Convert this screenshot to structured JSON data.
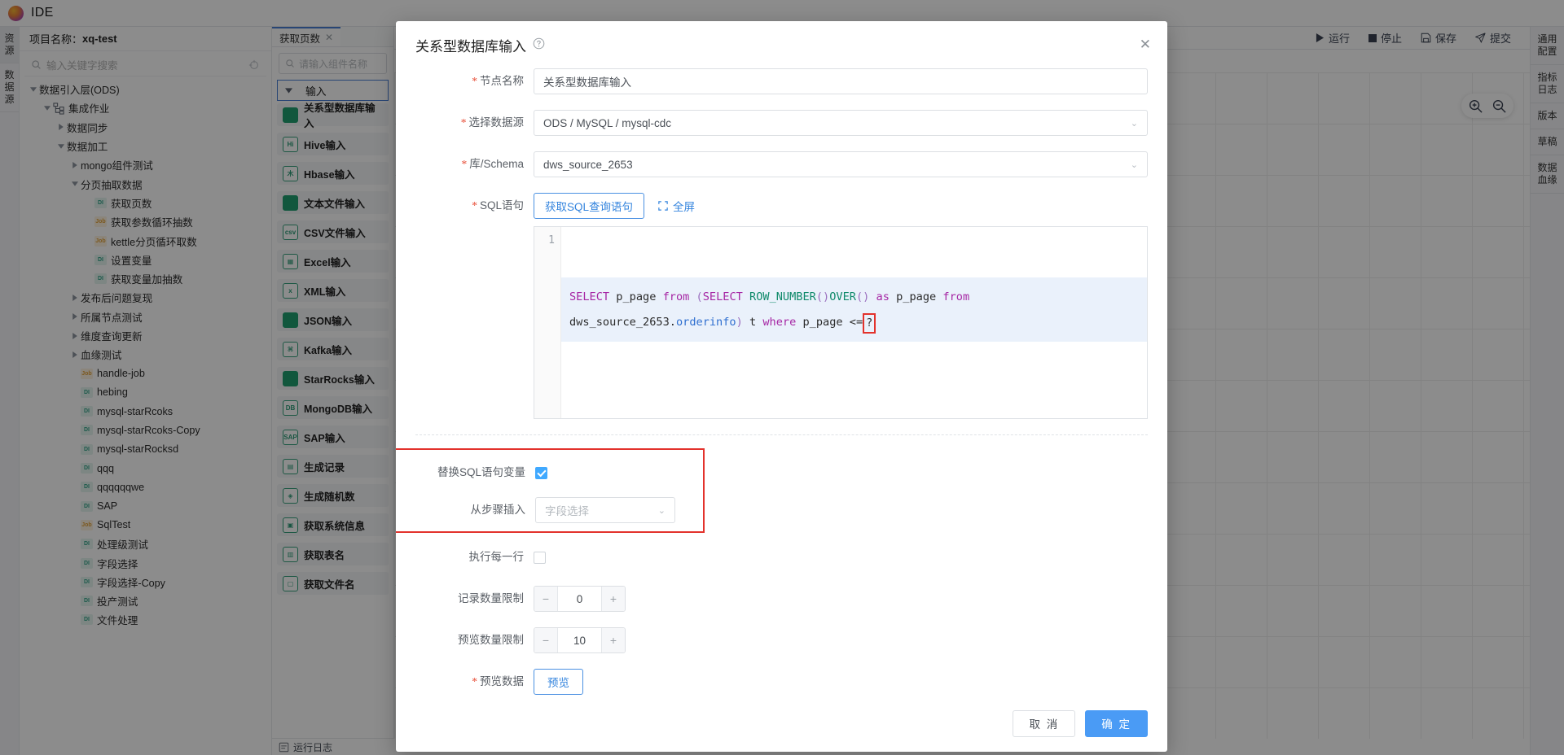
{
  "app": {
    "title": "IDE",
    "logo_icon": "flame-logo-icon"
  },
  "left_rail": {
    "tabs": [
      {
        "label": "资源",
        "active": true
      },
      {
        "label": "数据源",
        "active": false
      }
    ]
  },
  "tree": {
    "project_label": "项目名称：",
    "project_name": "xq-test",
    "search_placeholder": "输入关键字搜索",
    "search_icon": "search-icon",
    "target_icon": "crosshair-icon",
    "nodes": [
      {
        "label": "数据引入层(ODS)",
        "indent": 0,
        "caret": "down",
        "icon": ""
      },
      {
        "label": "集成作业",
        "indent": 1,
        "caret": "down",
        "icon": "net"
      },
      {
        "label": "数据同步",
        "indent": 2,
        "caret": "right",
        "icon": ""
      },
      {
        "label": "数据加工",
        "indent": 2,
        "caret": "down",
        "icon": ""
      },
      {
        "label": "mongo组件测试",
        "indent": 3,
        "caret": "right",
        "icon": ""
      },
      {
        "label": "分页抽取数据",
        "indent": 3,
        "caret": "down",
        "icon": ""
      },
      {
        "label": "获取页数",
        "indent": 4,
        "caret": "none",
        "icon": "DI"
      },
      {
        "label": "获取参数循环抽数",
        "indent": 4,
        "caret": "none",
        "icon": "Job"
      },
      {
        "label": "kettle分页循环取数",
        "indent": 4,
        "caret": "none",
        "icon": "Job"
      },
      {
        "label": "设置变量",
        "indent": 4,
        "caret": "none",
        "icon": "DI"
      },
      {
        "label": "获取变量加抽数",
        "indent": 4,
        "caret": "none",
        "icon": "DI"
      },
      {
        "label": "发布后问题复现",
        "indent": 3,
        "caret": "right",
        "icon": ""
      },
      {
        "label": "所属节点测试",
        "indent": 3,
        "caret": "right",
        "icon": ""
      },
      {
        "label": "维度查询更新",
        "indent": 3,
        "caret": "right",
        "icon": ""
      },
      {
        "label": "血缘测试",
        "indent": 3,
        "caret": "right",
        "icon": ""
      },
      {
        "label": "handle-job",
        "indent": 3,
        "caret": "none",
        "icon": "Job"
      },
      {
        "label": "hebing",
        "indent": 3,
        "caret": "none",
        "icon": "DI"
      },
      {
        "label": "mysql-starRcoks",
        "indent": 3,
        "caret": "none",
        "icon": "DI"
      },
      {
        "label": "mysql-starRcoks-Copy",
        "indent": 3,
        "caret": "none",
        "icon": "DI"
      },
      {
        "label": "mysql-starRocksd",
        "indent": 3,
        "caret": "none",
        "icon": "DI"
      },
      {
        "label": "qqq",
        "indent": 3,
        "caret": "none",
        "icon": "DI"
      },
      {
        "label": "qqqqqqwe",
        "indent": 3,
        "caret": "none",
        "icon": "DI"
      },
      {
        "label": "SAP",
        "indent": 3,
        "caret": "none",
        "icon": "DI"
      },
      {
        "label": "SqlTest",
        "indent": 3,
        "caret": "none",
        "icon": "Job"
      },
      {
        "label": "处理级测试",
        "indent": 3,
        "caret": "none",
        "icon": "DI"
      },
      {
        "label": "字段选择",
        "indent": 3,
        "caret": "none",
        "icon": "DI"
      },
      {
        "label": "字段选择-Copy",
        "indent": 3,
        "caret": "none",
        "icon": "DI"
      },
      {
        "label": "投产测试",
        "indent": 3,
        "caret": "none",
        "icon": "DI"
      },
      {
        "label": "文件处理",
        "indent": 3,
        "caret": "none",
        "icon": "DI"
      }
    ]
  },
  "palette": {
    "tab_label": "获取页数",
    "tab_close_icon": "close-icon",
    "search_placeholder": "请输入组件名称",
    "search_icon": "search-icon",
    "group_label": "输入",
    "group_caret_icon": "caret-down-icon",
    "components": [
      {
        "label": "关系型数据库输入",
        "icon": "database-icon",
        "solid": true
      },
      {
        "label": "Hive输入",
        "icon": "hive-icon",
        "glyph": "Hi"
      },
      {
        "label": "Hbase输入",
        "icon": "hbase-icon",
        "glyph": "木"
      },
      {
        "label": "文本文件输入",
        "icon": "text-file-icon",
        "solid": true
      },
      {
        "label": "CSV文件输入",
        "icon": "csv-file-icon",
        "glyph": "csv"
      },
      {
        "label": "Excel输入",
        "icon": "excel-icon",
        "glyph": "▦"
      },
      {
        "label": "XML输入",
        "icon": "xml-file-icon",
        "glyph": "x"
      },
      {
        "label": "JSON输入",
        "icon": "json-icon",
        "solid": true
      },
      {
        "label": "Kafka输入",
        "icon": "kafka-icon",
        "glyph": "⌘"
      },
      {
        "label": "StarRocks输入",
        "icon": "starrocks-icon",
        "solid": true
      },
      {
        "label": "MongoDB输入",
        "icon": "mongodb-icon",
        "glyph": "DB"
      },
      {
        "label": "SAP输入",
        "icon": "sap-icon",
        "glyph": "SAP"
      },
      {
        "label": "生成记录",
        "icon": "generate-record-icon",
        "glyph": "▤"
      },
      {
        "label": "生成随机数",
        "icon": "random-number-icon",
        "glyph": "◈"
      },
      {
        "label": "获取系统信息",
        "icon": "system-info-icon",
        "glyph": "▣"
      },
      {
        "label": "获取表名",
        "icon": "table-name-icon",
        "glyph": "▥"
      },
      {
        "label": "获取文件名",
        "icon": "file-name-icon",
        "glyph": "▢"
      }
    ],
    "run_log_label": "运行日志",
    "run_log_icon": "log-icon"
  },
  "canvas_toolbar": {
    "collapse_icon": "chevron-double-down-icon",
    "buttons": [
      {
        "label": "运行",
        "icon": "play-icon"
      },
      {
        "label": "停止",
        "icon": "stop-icon"
      },
      {
        "label": "保存",
        "icon": "save-icon"
      },
      {
        "label": "提交",
        "icon": "submit-icon"
      }
    ],
    "zoom_in_icon": "zoom-in-icon",
    "zoom_out_icon": "zoom-out-icon"
  },
  "right_rail": {
    "tabs": [
      {
        "label": "通用配置"
      },
      {
        "label": "指标日志"
      },
      {
        "label": "版本"
      },
      {
        "label": "草稿"
      },
      {
        "label": "数据血缘"
      }
    ]
  },
  "modal": {
    "title": "关系型数据库输入",
    "help_icon": "question-circle-icon",
    "close_icon": "close-icon",
    "fields": {
      "node_name_label": "节点名称",
      "node_name_value": "关系型数据库输入",
      "datasource_label": "选择数据源",
      "datasource_value": "ODS / MySQL / mysql-cdc",
      "schema_label": "库/Schema",
      "schema_value": "dws_source_2653",
      "sql_label": "SQL语句",
      "get_sql_button": "获取SQL查询语句",
      "fullscreen_link": "全屏",
      "fullscreen_icon": "expand-icon",
      "replace_var_label": "替换SQL语句变量",
      "replace_var_checked": true,
      "insert_from_step_label": "从步骤插入",
      "insert_from_step_value": "字段选择",
      "exec_each_row_label": "执行每一行",
      "exec_each_row_checked": false,
      "record_limit_label": "记录数量限制",
      "record_limit_value": "0",
      "preview_limit_label": "预览数量限制",
      "preview_limit_value": "10",
      "preview_data_label": "预览数据",
      "preview_button": "预览",
      "minus_icon": "minus-icon",
      "plus_icon": "plus-icon"
    },
    "sql": {
      "line_number": "1",
      "tokens_line1": [
        {
          "t": "SELECT",
          "c": "kw"
        },
        {
          "t": " p_page ",
          "c": "pln"
        },
        {
          "t": "from",
          "c": "kw"
        },
        {
          "t": " ",
          "c": "pln"
        },
        {
          "t": "(",
          "c": "pun"
        },
        {
          "t": "SELECT",
          "c": "kw"
        },
        {
          "t": " ",
          "c": "pln"
        },
        {
          "t": "ROW_NUMBER",
          "c": "fn"
        },
        {
          "t": "()",
          "c": "pun"
        },
        {
          "t": "OVER",
          "c": "fn"
        },
        {
          "t": "()",
          "c": "pun"
        },
        {
          "t": " ",
          "c": "pln"
        },
        {
          "t": "as",
          "c": "kw"
        },
        {
          "t": " p_page ",
          "c": "pln"
        },
        {
          "t": "from",
          "c": "kw"
        }
      ],
      "tokens_line2_pre": [
        {
          "t": "dws_source_2653.",
          "c": "pln"
        },
        {
          "t": "orderinfo",
          "c": "tbl"
        },
        {
          "t": ")",
          "c": "pun"
        },
        {
          "t": " t ",
          "c": "pln"
        },
        {
          "t": "where",
          "c": "kw"
        },
        {
          "t": " p_page ",
          "c": "pln"
        },
        {
          "t": "<=",
          "c": "pln"
        }
      ],
      "highlighted_token": "?",
      "full_text": "SELECT p_page from (SELECT ROW_NUMBER()OVER() as p_page from dws_source_2653.orderinfo) t where p_page <=?"
    },
    "footer": {
      "cancel": "取 消",
      "confirm": "确 定"
    }
  },
  "colors": {
    "accent_blue": "#4a9bf5",
    "link_blue": "#3585de",
    "highlight_red": "#e3322c",
    "checkbox_on": "#40a9ff",
    "di_green": "#35a589",
    "job_orange": "#e2a33b"
  }
}
